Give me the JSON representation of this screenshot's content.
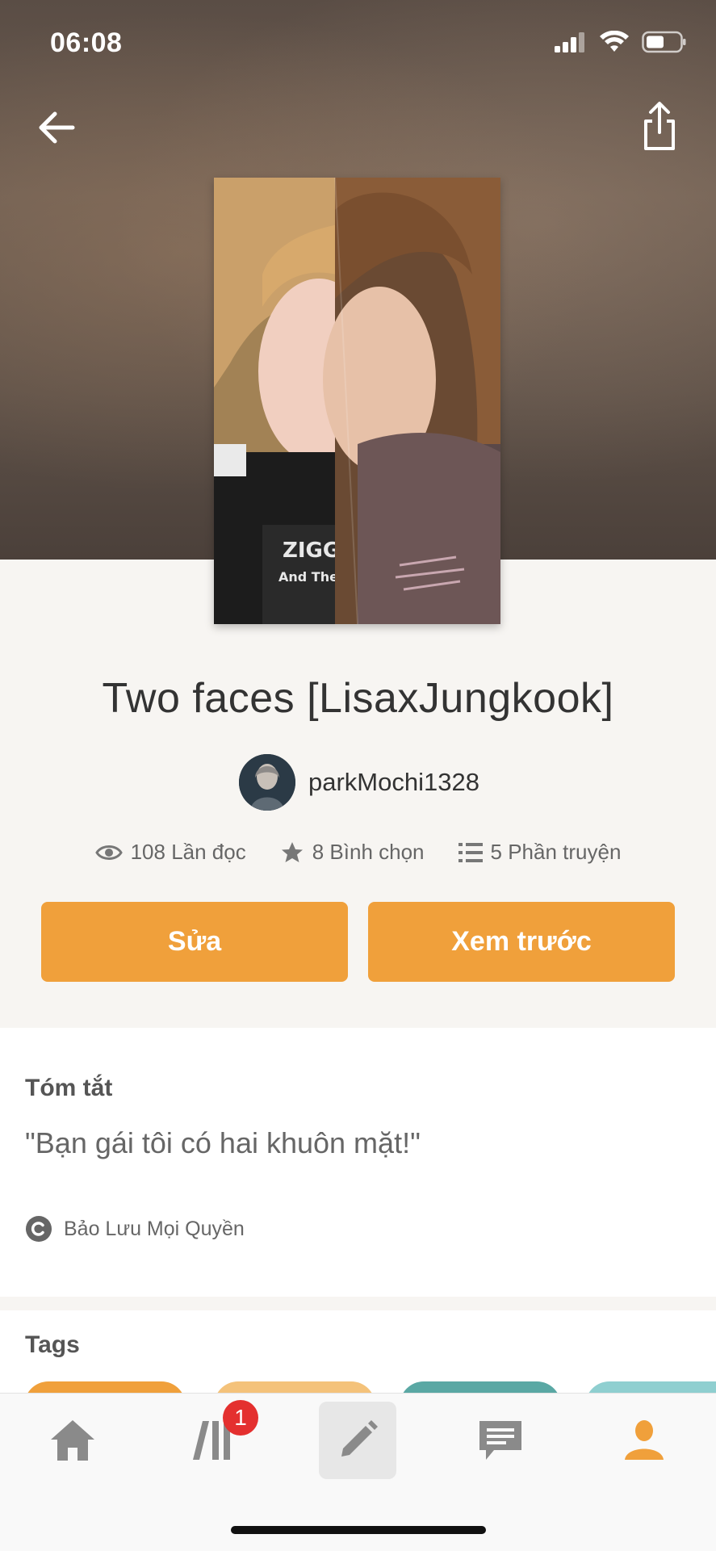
{
  "status_bar": {
    "time": "06:08"
  },
  "header": {
    "back_icon": "arrow-left-icon",
    "share_icon": "share-icon"
  },
  "story": {
    "title": "Two faces [LisaxJungkook]",
    "author": "parkMochi1328",
    "stats": {
      "reads": "108 Lần đọc",
      "votes": "8 Bình chọn",
      "parts": "5 Phần truyện"
    }
  },
  "actions": {
    "edit_label": "Sửa",
    "preview_label": "Xem trước"
  },
  "summary": {
    "heading": "Tóm tắt",
    "text": "\"Bạn gái tôi có hai khuôn mặt!\"",
    "copyright": "Bảo Lưu Mọi Quyền"
  },
  "tags": {
    "heading": "Tags",
    "pill_colors": [
      "#f0a03b",
      "#f4c27a",
      "#5aa8a4",
      "#8fcfd0"
    ]
  },
  "tabbar": {
    "items": [
      {
        "name": "home",
        "icon": "home-icon"
      },
      {
        "name": "library",
        "icon": "library-icon",
        "badge": "1"
      },
      {
        "name": "write",
        "icon": "pencil-icon",
        "active": true
      },
      {
        "name": "messages",
        "icon": "message-icon"
      },
      {
        "name": "profile",
        "icon": "profile-icon"
      }
    ]
  },
  "colors": {
    "accent": "#f0a03b",
    "badge": "#e4302f"
  }
}
